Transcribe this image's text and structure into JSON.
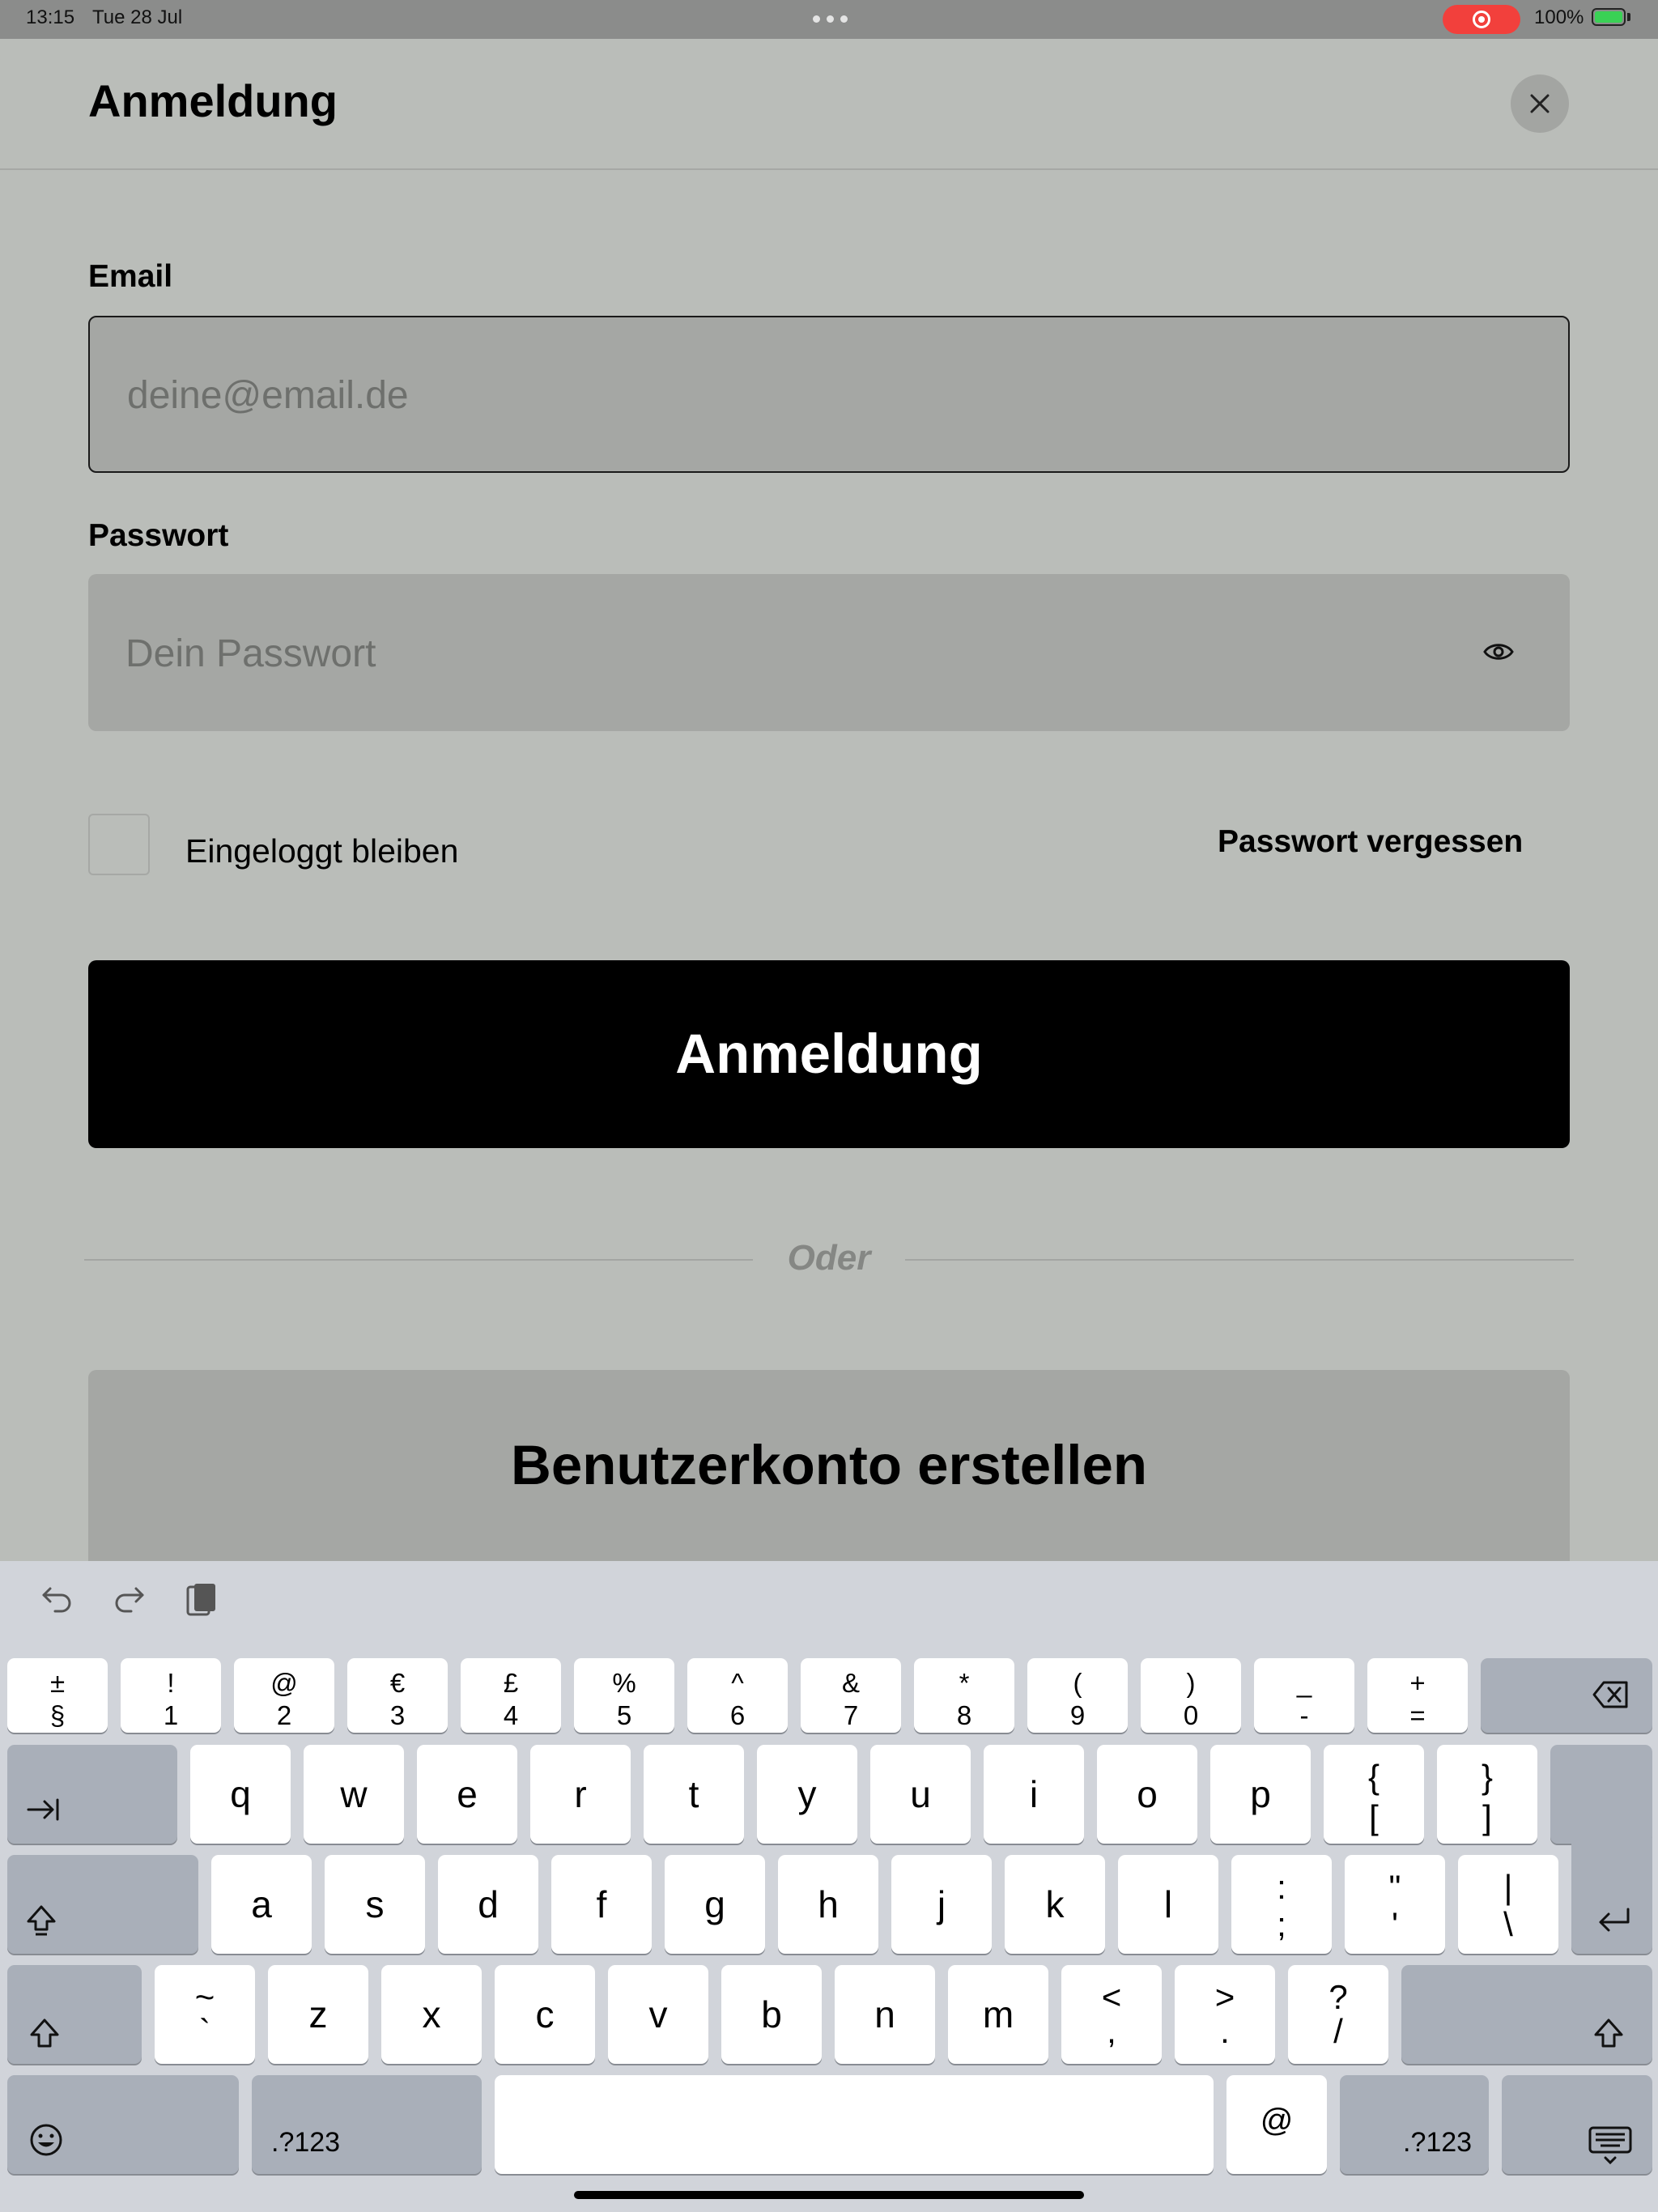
{
  "status_bar": {
    "time": "13:15",
    "date": "Tue 28 Jul",
    "battery": "100%",
    "recording_color": "#f2403c"
  },
  "sheet": {
    "title": "Anmeldung",
    "close_icon": "close-icon"
  },
  "form": {
    "email_label": "Email",
    "email_placeholder": "deine@email.de",
    "email_value": "",
    "password_label": "Passwort",
    "password_placeholder": "Dein Passwort",
    "password_value": "",
    "password_toggle_icon": "eye-icon",
    "remember_label": "Eingeloggt bleiben",
    "remember_checked": false,
    "forgot_label": "Passwort vergessen",
    "submit_label": "Anmeldung",
    "divider_label": "Oder",
    "create_account_label": "Benutzerkonto erstellen"
  },
  "keyboard": {
    "toolbar": [
      "undo-icon",
      "redo-icon",
      "paste-icon"
    ],
    "row1": [
      {
        "top": "±",
        "bottom": "§"
      },
      {
        "top": "!",
        "bottom": "1"
      },
      {
        "top": "@",
        "bottom": "2"
      },
      {
        "top": "€",
        "bottom": "3"
      },
      {
        "top": "£",
        "bottom": "4"
      },
      {
        "top": "%",
        "bottom": "5"
      },
      {
        "top": "^",
        "bottom": "6"
      },
      {
        "top": "&",
        "bottom": "7"
      },
      {
        "top": "*",
        "bottom": "8"
      },
      {
        "top": "(",
        "bottom": "9"
      },
      {
        "top": ")",
        "bottom": "0"
      },
      {
        "top": "_",
        "bottom": "-"
      },
      {
        "top": "+",
        "bottom": "="
      }
    ],
    "row2": [
      "q",
      "w",
      "e",
      "r",
      "t",
      "y",
      "u",
      "i",
      "o",
      "p"
    ],
    "row2_extra": [
      {
        "top": "{",
        "bottom": "["
      },
      {
        "top": "}",
        "bottom": "]"
      }
    ],
    "row3": [
      "a",
      "s",
      "d",
      "f",
      "g",
      "h",
      "j",
      "k",
      "l"
    ],
    "row3_extra": [
      {
        "top": ":",
        "bottom": ";"
      },
      {
        "top": "\"",
        "bottom": "'"
      },
      {
        "top": "|",
        "bottom": "\\"
      }
    ],
    "row4_first": {
      "top": "~",
      "bottom": "`"
    },
    "row4": [
      "z",
      "x",
      "c",
      "v",
      "b",
      "n",
      "m"
    ],
    "row4_extra": [
      {
        "top": "<",
        "bottom": ","
      },
      {
        "top": ">",
        "bottom": "."
      },
      {
        "top": "?",
        "bottom": "/"
      }
    ],
    "numbers_label": ".?123",
    "at_label": "@"
  }
}
